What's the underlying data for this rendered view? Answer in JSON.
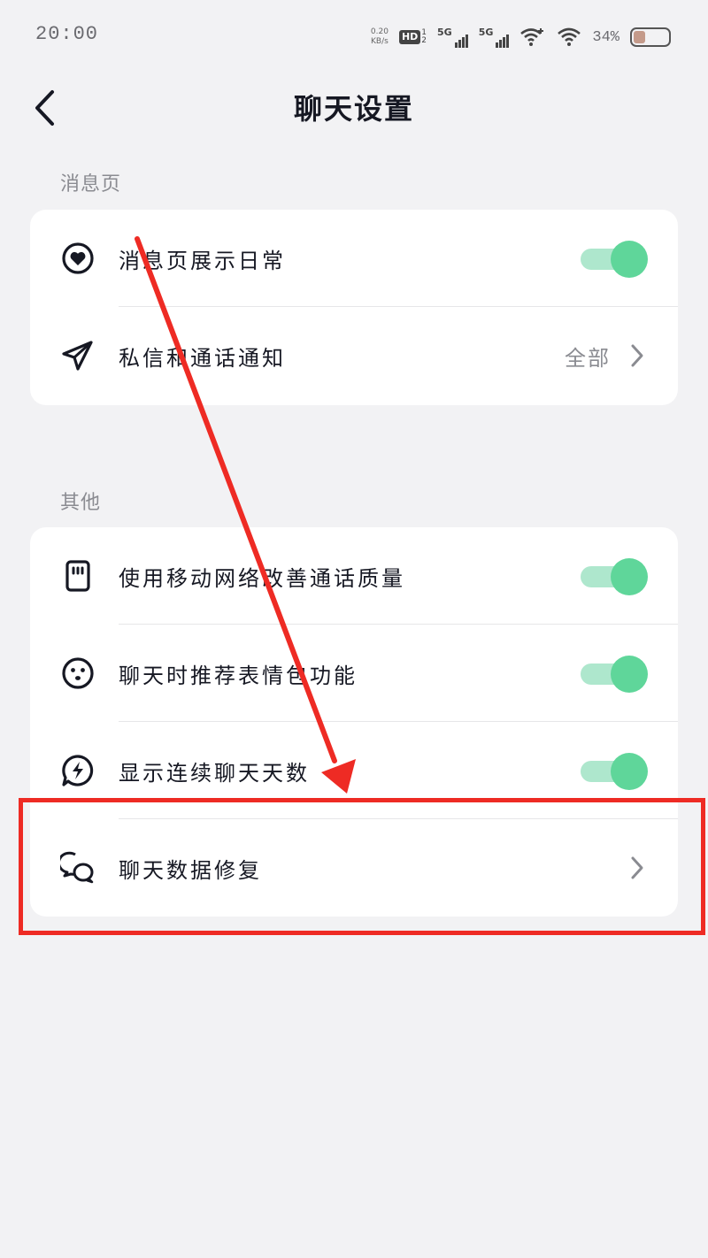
{
  "status_bar": {
    "time": "20:00",
    "net_speed_value": "0.20",
    "net_speed_unit": "KB/s",
    "hd_label": "HD",
    "hd_sub_top": "1",
    "hd_sub_bottom": "2",
    "signal_1_label": "5G",
    "signal_2_label": "5G",
    "battery_percent": "34%",
    "battery_level": 0.34
  },
  "header": {
    "title": "聊天设置"
  },
  "sections": [
    {
      "label": "消息页",
      "items": [
        {
          "label": "消息页展示日常",
          "icon": "heart-circle-icon",
          "control": "toggle",
          "on": true
        },
        {
          "label": "私信和通话通知",
          "icon": "paper-plane-icon",
          "control": "value",
          "value": "全部"
        }
      ]
    },
    {
      "label": "其他",
      "items": [
        {
          "label": "使用移动网络改善通话质量",
          "icon": "sim-card-icon",
          "control": "toggle",
          "on": true
        },
        {
          "label": "聊天时推荐表情包功能",
          "icon": "smiley-icon",
          "control": "toggle",
          "on": true
        },
        {
          "label": "显示连续聊天天数",
          "icon": "lightning-bubble-icon",
          "control": "toggle",
          "on": true
        },
        {
          "label": "聊天数据修复",
          "icon": "chat-bubbles-icon",
          "control": "chevron"
        }
      ]
    }
  ],
  "colors": {
    "background": "#f2f2f4",
    "card": "#ffffff",
    "toggle_on": "#5fd69a",
    "annotation": "#ee2b24"
  }
}
